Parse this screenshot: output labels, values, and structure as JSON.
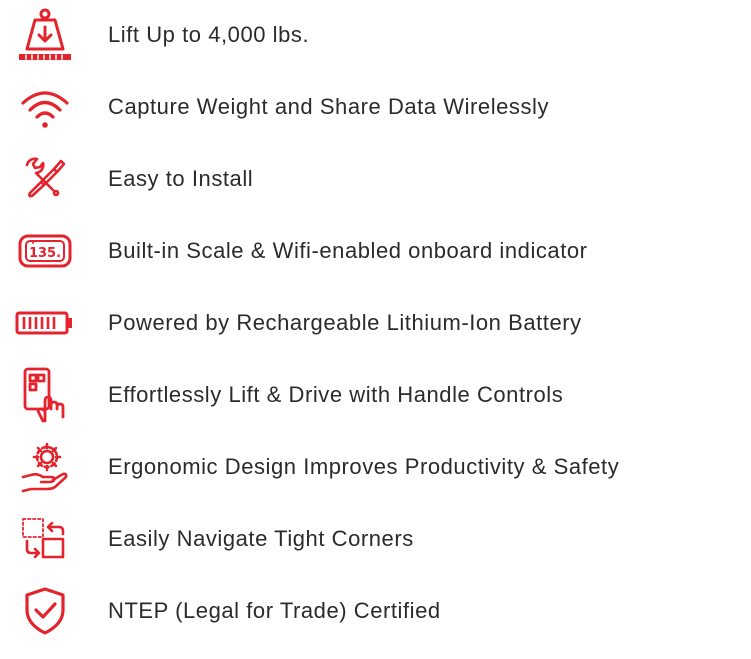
{
  "accent_color": "#e5232d",
  "text_color": "#2b2b2b",
  "features": [
    {
      "icon": "weight-lift-icon",
      "label": "Lift Up to 4,000 lbs."
    },
    {
      "icon": "wifi-icon",
      "label": "Capture Weight and Share Data Wirelessly"
    },
    {
      "icon": "tools-icon",
      "label": "Easy to Install"
    },
    {
      "icon": "scale-indicator-icon",
      "label": "Built-in Scale & Wifi-enabled onboard indicator",
      "display_text": "135."
    },
    {
      "icon": "battery-icon",
      "label": "Powered by Rechargeable Lithium-Ion Battery"
    },
    {
      "icon": "handle-controls-icon",
      "label": "Effortlessly Lift & Drive with Handle Controls"
    },
    {
      "icon": "ergonomic-gear-hand-icon",
      "label": "Ergonomic Design Improves Productivity & Safety"
    },
    {
      "icon": "tight-corners-icon",
      "label": "Easily Navigate Tight Corners"
    },
    {
      "icon": "shield-check-icon",
      "label": "NTEP (Legal for Trade) Certified"
    }
  ]
}
